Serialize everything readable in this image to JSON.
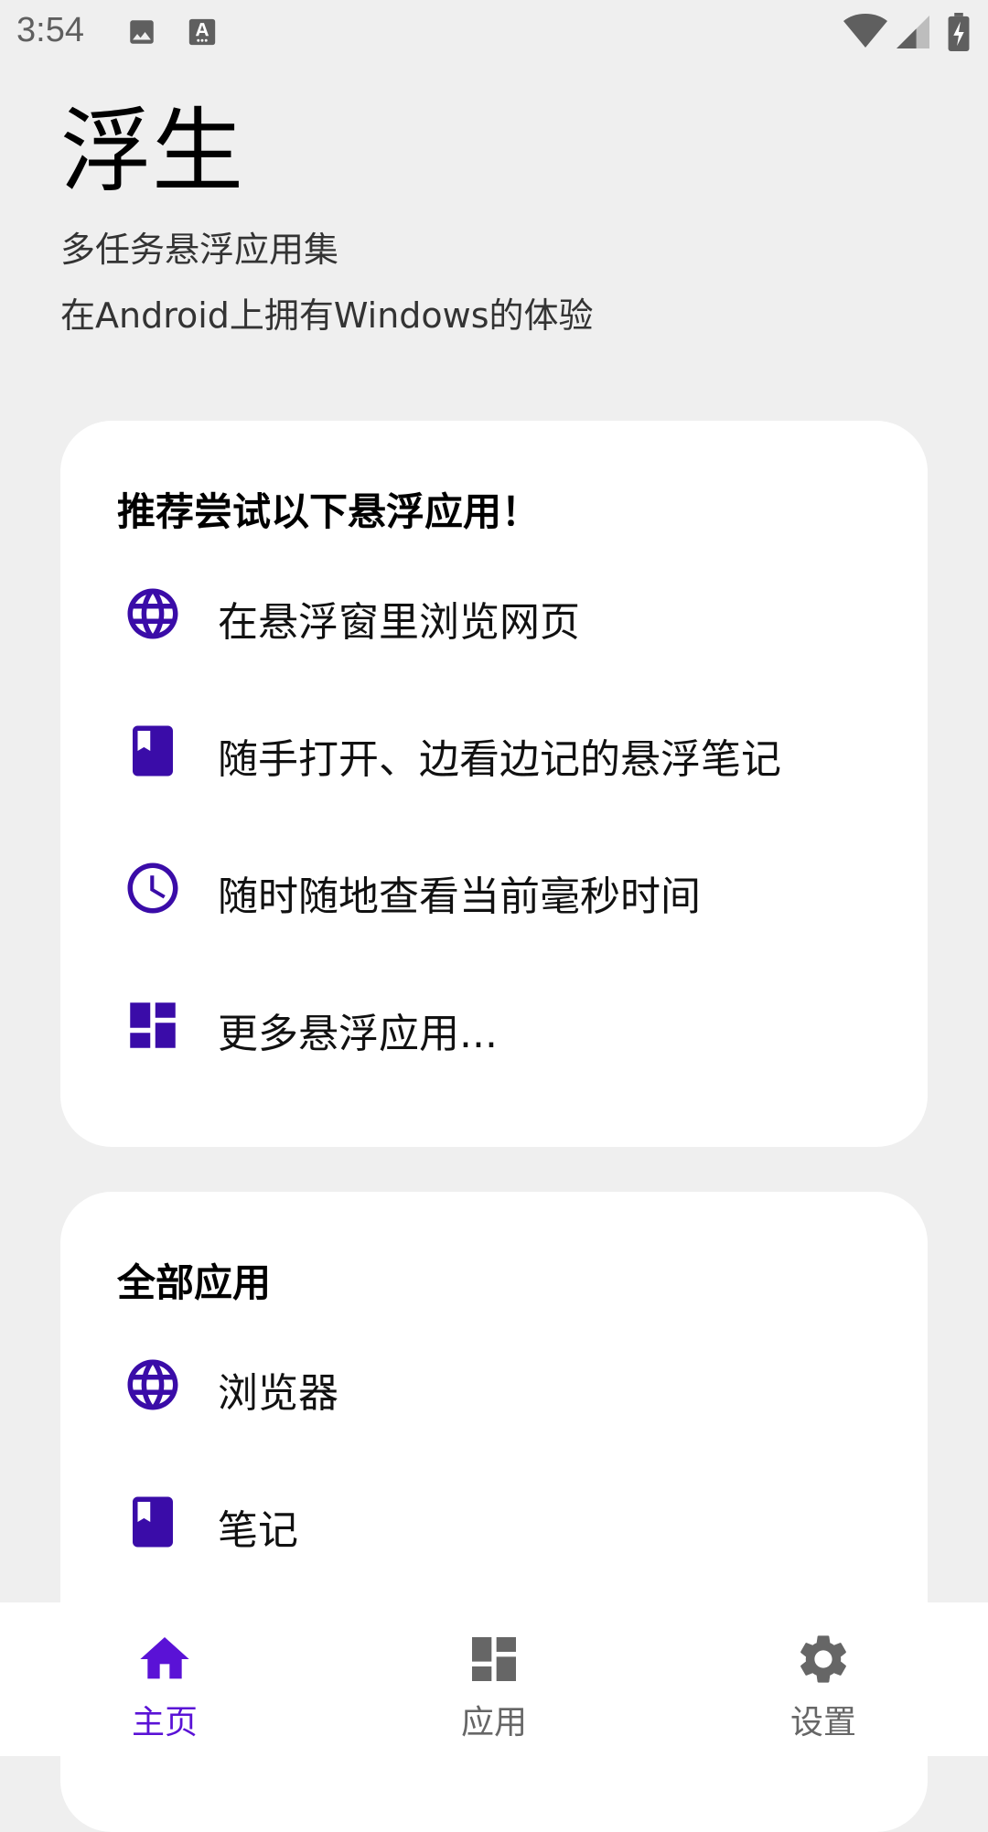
{
  "status_bar": {
    "time": "3:54",
    "icons": [
      "image-icon",
      "keyboard-a-icon",
      "wifi-icon",
      "signal-icon",
      "battery-charging-icon"
    ]
  },
  "header": {
    "title": "浮生",
    "subtitle": "多任务悬浮应用集",
    "description": "在Android上拥有Windows的体验"
  },
  "recommend_card": {
    "title": "推荐尝试以下悬浮应用！",
    "items": [
      {
        "label": "在悬浮窗里浏览网页",
        "icon": "globe-icon"
      },
      {
        "label": "随手打开、边看边记的悬浮笔记",
        "icon": "book-icon"
      },
      {
        "label": "随时随地查看当前毫秒时间",
        "icon": "clock-icon"
      },
      {
        "label": "更多悬浮应用...",
        "icon": "dashboard-icon"
      }
    ]
  },
  "all_apps_card": {
    "title": "全部应用",
    "items": [
      {
        "label": "浏览器",
        "icon": "globe-icon"
      },
      {
        "label": "笔记",
        "icon": "book-icon"
      }
    ]
  },
  "bottom_nav": {
    "items": [
      {
        "label": "主页",
        "icon": "home-icon",
        "active": true
      },
      {
        "label": "应用",
        "icon": "dashboard-icon",
        "active": false
      },
      {
        "label": "设置",
        "icon": "gear-icon",
        "active": false
      }
    ]
  },
  "colors": {
    "accent": "#5a12d6",
    "icon": "#3a0ca8",
    "background": "#efefef",
    "card": "#ffffff",
    "nav_inactive": "#666666"
  }
}
